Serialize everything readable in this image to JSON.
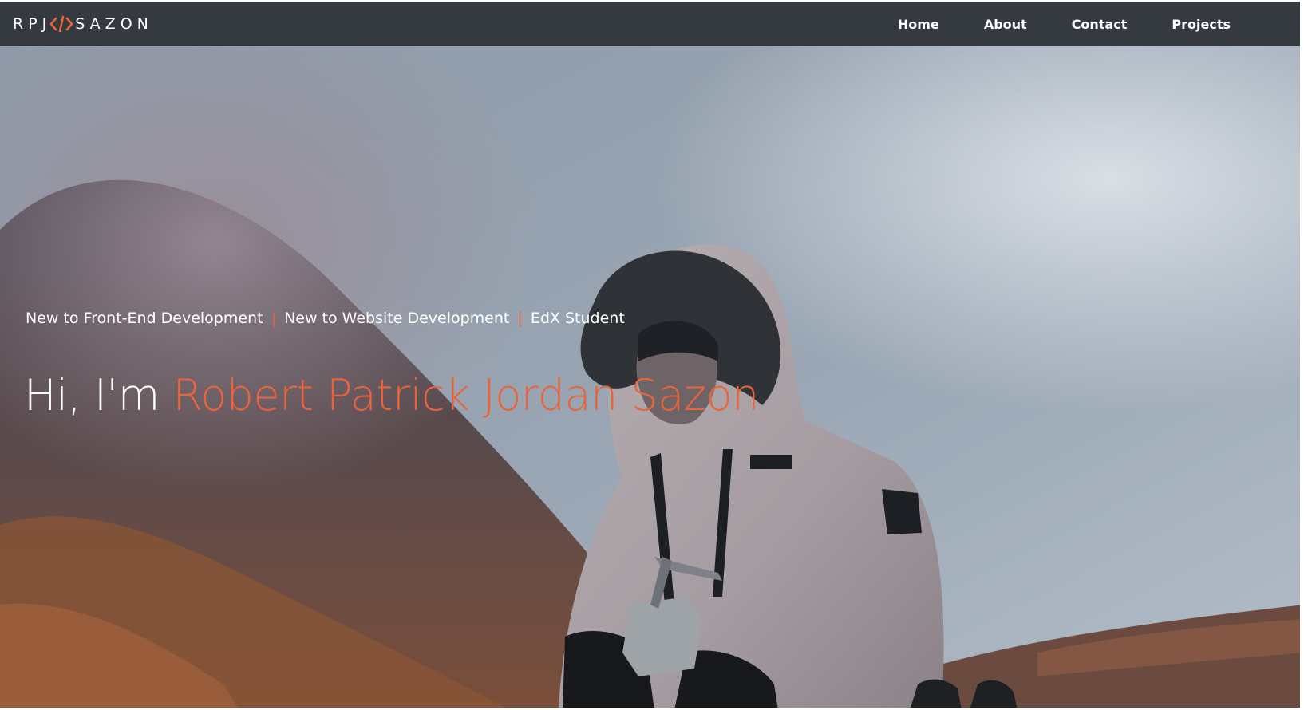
{
  "nav": {
    "brand_left": "RPJ",
    "brand_icon": "code-icon",
    "brand_right": "SAZON",
    "links": [
      "Home",
      "About",
      "Contact",
      "Projects"
    ]
  },
  "hero": {
    "taglines": [
      "New to Front-End Development",
      "New to Website Development",
      "EdX Student"
    ],
    "separator": "|",
    "greeting": "Hi, I'm ",
    "name": "Robert Patrick Jordan Sazon"
  },
  "colors": {
    "navbar": "#343a40",
    "accent": "#e8643a",
    "text": "#ffffff"
  }
}
